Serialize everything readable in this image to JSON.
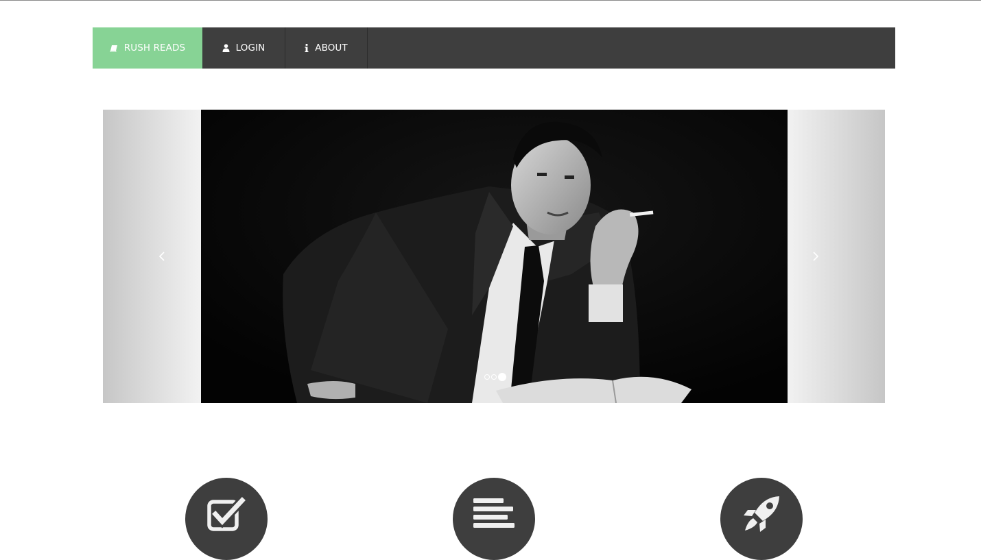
{
  "navbar": {
    "brand": {
      "label": "RUSH READS",
      "icon": "book-icon"
    },
    "items": [
      {
        "label": "LOGIN",
        "icon": "user-icon"
      },
      {
        "label": "ABOUT",
        "icon": "info-icon"
      }
    ]
  },
  "carousel": {
    "slide_count": 3,
    "active_index": 2,
    "prev_icon": "chevron-left-icon",
    "next_icon": "chevron-right-icon"
  },
  "features": [
    {
      "icon": "check-square-icon"
    },
    {
      "icon": "align-left-icon"
    },
    {
      "icon": "rocket-icon"
    }
  ],
  "colors": {
    "brand_green": "#87d395",
    "navbar_dark": "#3e3e3e",
    "feature_circle": "#3e3e3e"
  }
}
